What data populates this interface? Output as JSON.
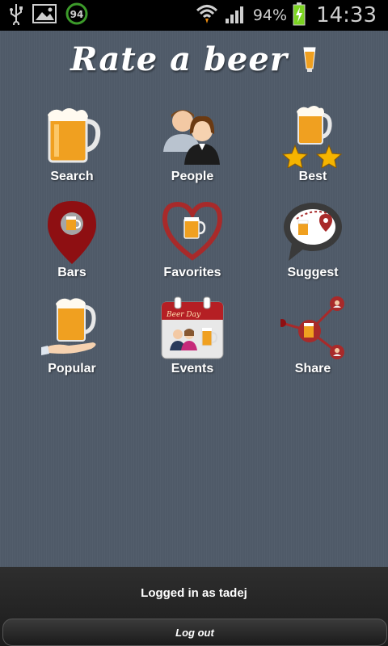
{
  "status_bar": {
    "badge_number": "94",
    "battery_percent": "94%",
    "time": "14:33",
    "icons": [
      "usb-icon",
      "image-icon",
      "badge-94-icon",
      "wifi-icon",
      "signal-icon",
      "battery-icon"
    ]
  },
  "app": {
    "title": "Rate a beer"
  },
  "menu": [
    {
      "label": "Search",
      "icon": "beer-mug-icon"
    },
    {
      "label": "People",
      "icon": "people-icon"
    },
    {
      "label": "Best",
      "icon": "beer-stars-icon"
    },
    {
      "label": "Bars",
      "icon": "map-pin-beer-icon"
    },
    {
      "label": "Favorites",
      "icon": "heart-beer-icon"
    },
    {
      "label": "Suggest",
      "icon": "speech-bubble-icon"
    },
    {
      "label": "Popular",
      "icon": "beer-hand-icon"
    },
    {
      "label": "Events",
      "icon": "calendar-icon"
    },
    {
      "label": "Share",
      "icon": "share-network-icon"
    }
  ],
  "calendar_text": "Beer Day",
  "footer": {
    "logged_in_text": "Logged in as tadej",
    "logout_label": "Log out"
  },
  "colors": {
    "background": "#4f5a68",
    "footer": "#232323",
    "beer": "#f0a020",
    "heart": "#a82a2a",
    "pin": "#8e0f12"
  }
}
